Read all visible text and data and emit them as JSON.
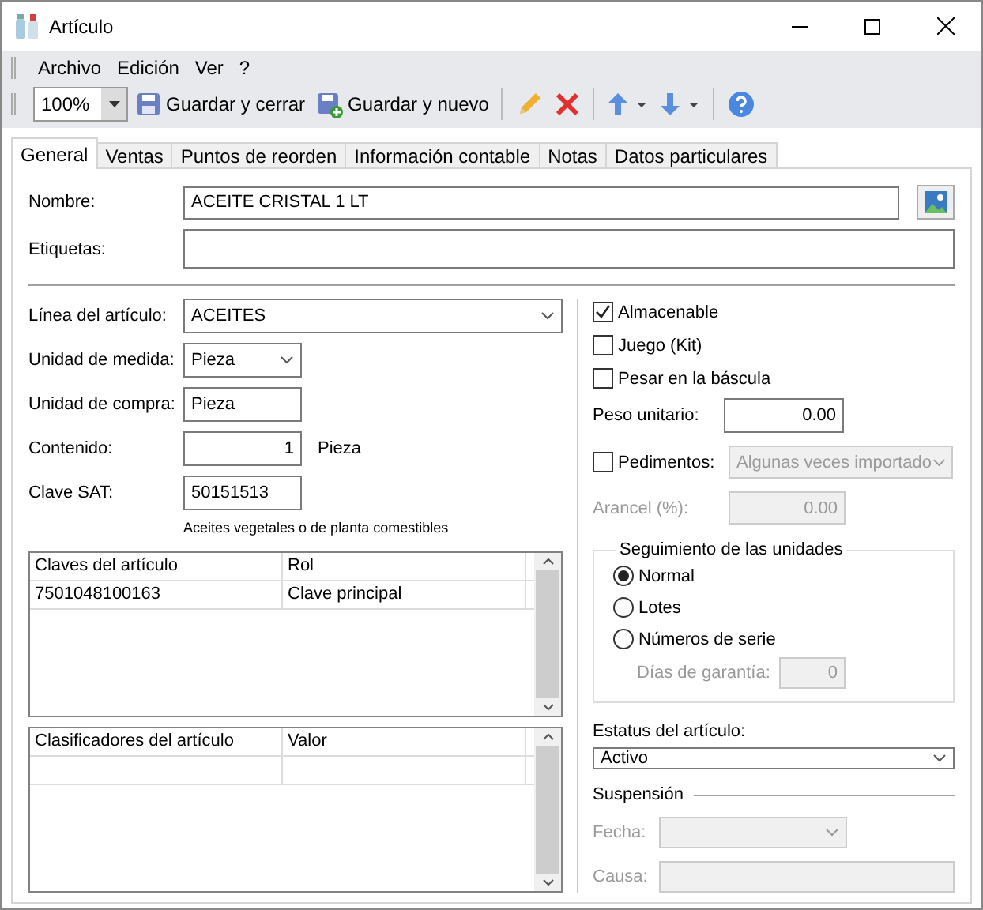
{
  "window": {
    "title": "Artículo"
  },
  "menu": [
    {
      "label": "Archivo"
    },
    {
      "label": "Edición"
    },
    {
      "label": "Ver"
    },
    {
      "label": "?"
    }
  ],
  "toolbar": {
    "zoom": "100%",
    "items": [
      {
        "kind": "save",
        "label": "Guardar y cerrar"
      },
      {
        "kind": "save-new",
        "label": "Guardar y nuevo"
      },
      {
        "kind": "separator"
      },
      {
        "kind": "edit"
      },
      {
        "kind": "delete"
      },
      {
        "kind": "separator"
      },
      {
        "kind": "up"
      },
      {
        "kind": "down"
      },
      {
        "kind": "separator"
      },
      {
        "kind": "help"
      }
    ]
  },
  "tabs": [
    {
      "label": "General",
      "selected": true
    },
    {
      "label": "Ventas",
      "selected": false
    },
    {
      "label": "Puntos de reorden",
      "selected": false
    },
    {
      "label": "Información contable",
      "selected": false
    },
    {
      "label": "Notas",
      "selected": false
    },
    {
      "label": "Datos particulares",
      "selected": false
    }
  ],
  "top_fields": [
    {
      "label": "Nombre:",
      "value": "ACEITE CRISTAL 1 LT",
      "image_button": true
    },
    {
      "label": "Etiquetas:",
      "image_button": false
    }
  ],
  "left_fields": [
    {
      "kind": "dropdown",
      "label": "Línea del artículo:",
      "value": "ACEITES",
      "wide": true
    },
    {
      "kind": "dropdown",
      "label": "Unidad de medida:",
      "value": "Pieza",
      "wide": false
    },
    {
      "kind": "text",
      "label": "Unidad de compra:",
      "value": "Pieza"
    },
    {
      "kind": "number",
      "label": "Contenido:",
      "value": "1",
      "unit": "Pieza"
    },
    {
      "kind": "text",
      "label": "Clave SAT:",
      "value": "50151513"
    }
  ],
  "sat_description": "Aceites vegetales o  de planta comestibles",
  "grids": [
    {
      "columns": [
        "Claves del artículo",
        "Rol"
      ],
      "rows": [
        [
          "7501048100163",
          "Clave principal"
        ]
      ]
    },
    {
      "columns": [
        "Clasificadores del artículo",
        "Valor"
      ],
      "rows": [
        [
          "",
          ""
        ]
      ]
    }
  ],
  "checks": [
    {
      "label": "Almacenable",
      "checked": true
    },
    {
      "label": "Juego (Kit)",
      "checked": false
    },
    {
      "label": "Pesar en la báscula",
      "checked": false
    }
  ],
  "peso": {
    "label": "Peso unitario:",
    "value": "0.00"
  },
  "pedimentos": {
    "label": "Pedimentos:",
    "checked": false,
    "value": "Algunas veces importado",
    "disabled": true
  },
  "arancel": {
    "label": "Arancel (%):",
    "value": "0.00",
    "disabled": true
  },
  "tracking": {
    "title": "Seguimiento de las unidades",
    "options": [
      {
        "label": "Normal",
        "selected": true
      },
      {
        "label": "Lotes",
        "selected": false
      },
      {
        "label": "Números de serie",
        "selected": false
      }
    ],
    "warranty": {
      "label": "Días de garantía:",
      "value": "0",
      "disabled": true
    }
  },
  "status": {
    "label": "Estatus del artículo:",
    "value": "Activo"
  },
  "suspension": {
    "title": "Suspensión",
    "fecha": {
      "label": "Fecha:",
      "disabled": true
    },
    "causa": {
      "label": "Causa:",
      "disabled": true
    }
  }
}
